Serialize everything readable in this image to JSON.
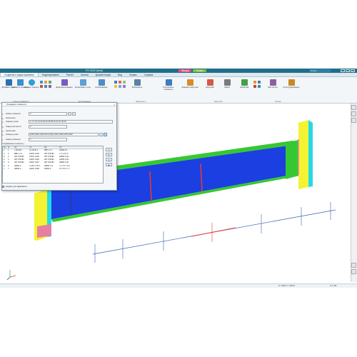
{
  "app": {
    "title": "FS 2020 (beta)",
    "mode_buttons": [
      "Фигура",
      "Разрез"
    ],
    "window_buttons": [
      "–",
      "□",
      "×"
    ],
    "search_placeholder": "Поиск"
  },
  "tabs": [
    {
      "label": "Создание и редактирование",
      "active": true
    },
    {
      "label": "Моделирование",
      "active": false
    },
    {
      "label": "Расчёт",
      "active": false
    },
    {
      "label": "Анализ",
      "active": false
    },
    {
      "label": "Документация",
      "active": false
    },
    {
      "label": "Вид",
      "active": false
    },
    {
      "label": "Сервис",
      "active": false
    },
    {
      "label": "Справка",
      "active": false
    }
  ],
  "ribbon": {
    "buttons": [
      {
        "label": "Добавить узел",
        "color": "#2b6fb5"
      },
      {
        "label": "Добавить элемент",
        "color": "#3b8fd1"
      },
      {
        "label": "Создать модель",
        "color": "#2f9fd8"
      },
      {
        "label": "Деформирование",
        "color": "#7a5bc2"
      },
      {
        "label": "Копировать узлы",
        "color": "#5aa0d6"
      },
      {
        "label": "Копирование",
        "color": "#4d8ec7"
      },
      {
        "label": "Фрагменты",
        "color": "#5c7fa8"
      },
      {
        "label": "Копировать элементы",
        "color": "#3f7bbf"
      },
      {
        "label": "Задание нагрузки",
        "color": "#d98b2b"
      },
      {
        "label": "Нагрузки",
        "color": "#d35a4a"
      },
      {
        "label": "Связи",
        "color": "#7a7a7a"
      },
      {
        "label": "Свойства",
        "color": "#43a047"
      },
      {
        "label": "Жёсткости",
        "color": "#8e5ea2"
      },
      {
        "label": "Конструирование",
        "color": "#c48a2a"
      }
    ],
    "groups": [
      "Узлы и элементы",
      "Копирование",
      "Фрагменты",
      "Нагрузки",
      "Схема"
    ]
  },
  "dialog": {
    "title": "Создание элемента",
    "fields": [
      {
        "num": "1",
        "label": "Номер элемента",
        "value": "4"
      },
      {
        "num": "2",
        "label": "Начальное",
        "value": ""
      },
      {
        "num": "3",
        "label": "Номера узлов",
        "value": "1,4,7,10,13,16,19,22,25,28,31,34,37,40,43"
      },
      {
        "num": "4",
        "label": "Номер жёсткости",
        "value": "2"
      },
      {
        "num": "5",
        "label": "Начальная",
        "value": ""
      },
      {
        "num": "6",
        "label": "Номера узлов",
        "value": "1002,1003,1012,1013,1022,1023,1032,1033,1042"
      },
      {
        "num": "7",
        "label": "Номер элемента",
        "value": "7"
      }
    ],
    "section_label": "Создаваемые элементы",
    "table": {
      "headers": [
        "№",
        "N",
        "Х1",
        "Y1",
        "Х2",
        "Y2"
      ],
      "rows": [
        [
          "1",
          "1",
          "1 68 400 ...",
          "14 15 50 1...",
          "988 1 2 2 ...",
          "22305 10 ..."
        ],
        [
          "2",
          "2",
          "888 1 2 2 ...",
          "22307 1004",
          "287 678 88...",
          "1 2 3 4 5 6"
        ],
        [
          "3",
          "3",
          "287 678 88...",
          "22307 1005",
          "287 678 88...",
          "48050 9 93"
        ],
        [
          "4",
          "4",
          "287 678 88...",
          "22307 1006",
          "287 678 88...",
          "42050 9 93"
        ],
        [
          "5",
          "5",
          "287 678 88...",
          "22307 1007",
          "287 678 88...",
          "48050 9 93"
        ],
        [
          "6",
          "6",
          "28002 2...",
          "71 83 7 26 0...",
          "28002 2 9...",
          "7 1 2 5 7 9 5"
        ],
        [
          "7",
          "7",
          "28002 2...",
          "22307 1008",
          "28002 2...",
          "8 7 8 5 4 7 7"
        ]
      ]
    },
    "side_buttons": [
      "+",
      "✎",
      "×",
      "▲"
    ],
    "checkbox_label": "Создать для фрагмента",
    "checkbox_checked": false
  },
  "status": {
    "left": "X: 148.4   Y: 402.5",
    "right": "Z: 0.00"
  },
  "colors": {
    "beam_top": "#36c832",
    "beam_side": "#1b3fe0",
    "column": "#f3f331",
    "column_side": "#26d9e6",
    "bracket": "#e67fa1",
    "stiffener": "#e03a3a",
    "titlebar": "#1f6f8b"
  },
  "icons": [
    "search-icon",
    "close-icon",
    "minimize-icon",
    "maximize-icon",
    "axis-icon"
  ]
}
